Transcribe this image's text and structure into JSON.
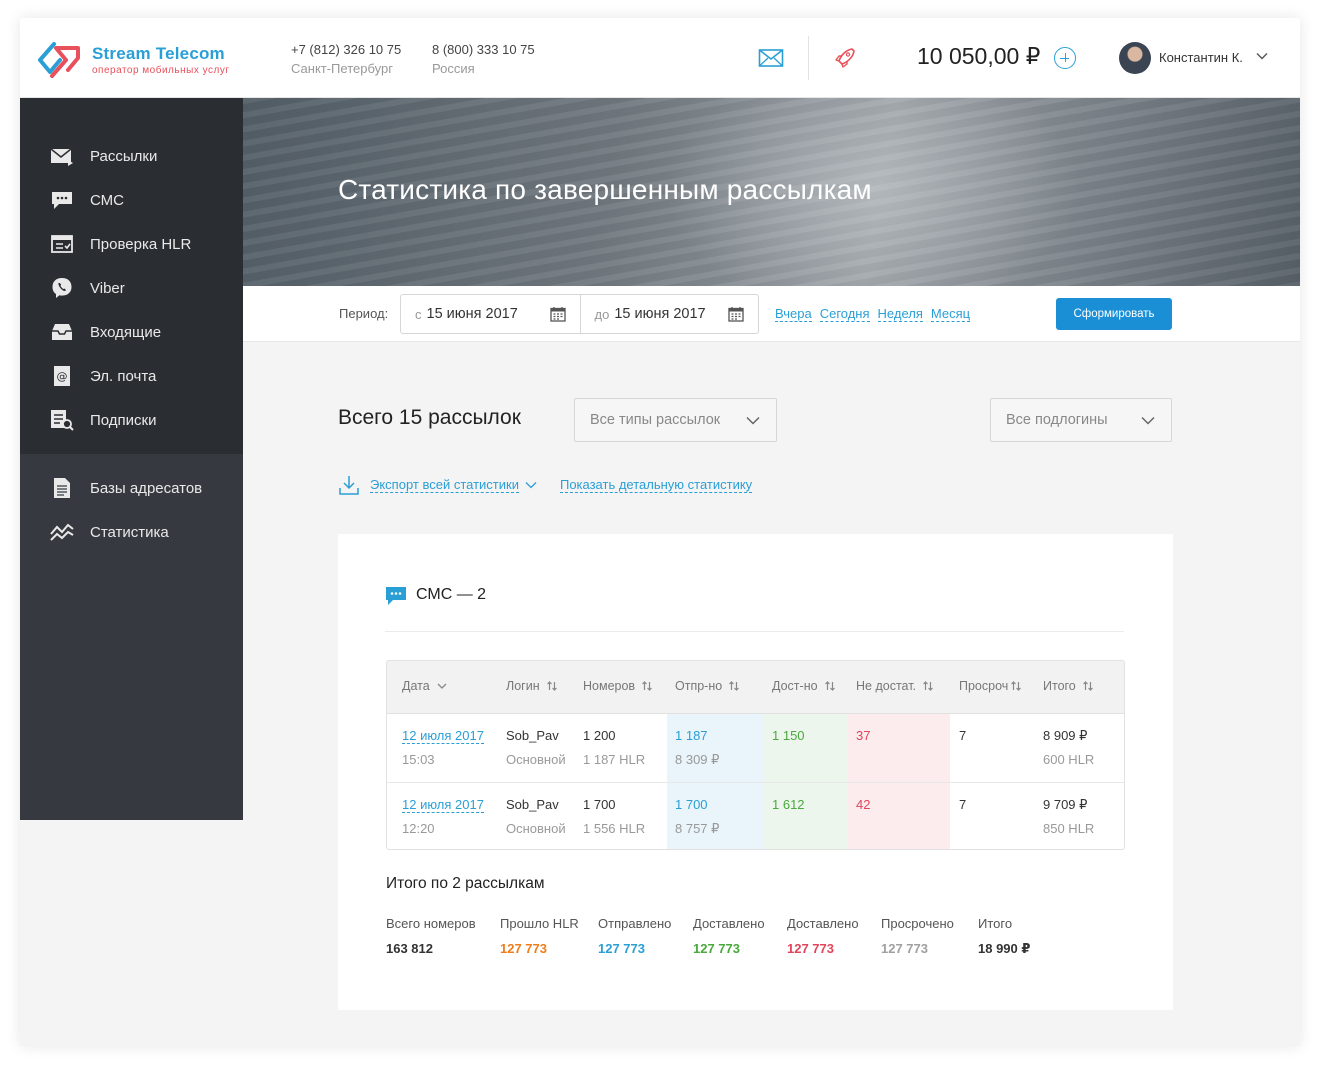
{
  "brand": {
    "name": "Stream Telecom",
    "tagline": "оператор мобильных услуг",
    "primary_color": "#2a9fd6",
    "accent_color": "#e8505b"
  },
  "header": {
    "phones": [
      {
        "number": "+7 (812) 326 10 75",
        "city": "Санкт-Петербург"
      },
      {
        "number": "8 (800) 333 10 75",
        "city": "Россия"
      }
    ],
    "icons": [
      "envelope-icon",
      "rocket-icon",
      "add-balance-icon",
      "chevron-down-icon"
    ],
    "balance": "10 050,00 ₽",
    "user": {
      "name": "Константин К."
    }
  },
  "sidebar": {
    "primary_items": [
      {
        "label": "Рассылки",
        "icon": "mailing-icon"
      },
      {
        "label": "СМС",
        "icon": "sms-icon"
      },
      {
        "label": "Проверка HLR",
        "icon": "hlr-check-icon"
      },
      {
        "label": "Viber",
        "icon": "viber-icon"
      },
      {
        "label": "Входящие",
        "icon": "inbox-icon"
      },
      {
        "label": "Эл. почта",
        "icon": "email-icon"
      },
      {
        "label": "Подписки",
        "icon": "subscriptions-icon"
      }
    ],
    "secondary_items": [
      {
        "label": "Базы адресатов",
        "icon": "address-book-icon"
      },
      {
        "label": "Статистика",
        "icon": "statistics-icon"
      }
    ]
  },
  "hero": {
    "title": "Статистика по завершенным рассылкам"
  },
  "filter": {
    "period_label": "Период:",
    "from_prefix": "с",
    "from_date": "15 июня 2017",
    "to_prefix": "до",
    "to_date": "15 июня 2017",
    "quick_links": [
      "Вчера",
      "Сегодня",
      "Неделя",
      "Месяц"
    ],
    "submit_label": "Сформировать"
  },
  "summary": {
    "title": "Всего 15 рассылок",
    "type_select": "Все типы рассылок",
    "sublogin_select": "Все подлогины",
    "export_label": "Экспорт всей статистики",
    "detail_label": "Показать детальную статистику"
  },
  "card": {
    "title": "СМС — 2",
    "columns": [
      "Дата",
      "Логин",
      "Номеров",
      "Отпр-но",
      "Дост-но",
      "Не достат.",
      "Просроч",
      "Итого"
    ],
    "rows": [
      {
        "date": "12 июля 2017",
        "time": "15:03",
        "login": "Sob_Pav",
        "login_type": "Основной",
        "numbers": "1 200",
        "numbers_hlr": "1 187 HLR",
        "sent": "1 187",
        "sent_sum": "8 309 ₽",
        "delivered": "1 150",
        "not_delivered": "37",
        "expired": "7",
        "total": "8 909 ₽",
        "total_hlr": "600 HLR"
      },
      {
        "date": "12 июля 2017",
        "time": "12:20",
        "login": "Sob_Pav",
        "login_type": "Основной",
        "numbers": "1 700",
        "numbers_hlr": "1 556 HLR",
        "sent": "1 700",
        "sent_sum": "8 757 ₽",
        "delivered": "1 612",
        "not_delivered": "42",
        "expired": "7",
        "total": "9 709 ₽",
        "total_hlr": "850 HLR"
      }
    ],
    "totals_title": "Итого по 2 рассылкам",
    "totals": [
      {
        "label": "Всего номеров",
        "value": "163 812",
        "color": "#333333"
      },
      {
        "label": "Прошло HLR",
        "value": "127 773",
        "color": "#f07d1a"
      },
      {
        "label": "Отправлено",
        "value": "127 773",
        "color": "#2a9fd6"
      },
      {
        "label": "Доставлено",
        "value": "127 773",
        "color": "#4aa83e"
      },
      {
        "label": "Доставлено",
        "value": "127 773",
        "color": "#e0455c"
      },
      {
        "label": "Просрочено",
        "value": "127 773",
        "color": "#a0a0a0"
      },
      {
        "label": "Итого",
        "value": "18 990 ₽",
        "color": "#333333"
      }
    ]
  }
}
